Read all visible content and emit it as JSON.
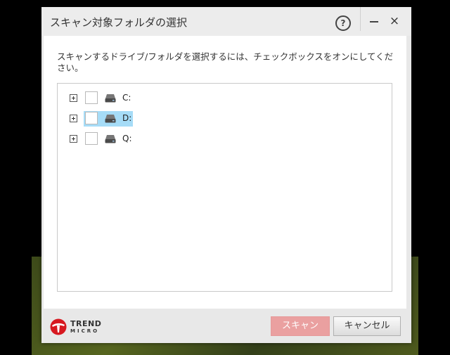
{
  "dialog": {
    "title": "スキャン対象フォルダの選択",
    "help_label": "?",
    "close_label": "×"
  },
  "instruction": "スキャンするドライブ/フォルダを選択するには、チェックボックスをオンにしてください。",
  "drives": [
    {
      "label": "C:",
      "checked": false,
      "selected": false
    },
    {
      "label": "D:",
      "checked": false,
      "selected": true
    },
    {
      "label": "Q:",
      "checked": false,
      "selected": false
    }
  ],
  "logo": {
    "line1": "TREND",
    "line2": "MICRO",
    "color": "#d71920"
  },
  "buttons": {
    "scan_label": "スキャン",
    "cancel_label": "キャンセル"
  },
  "colors": {
    "selection": "#a6dcf7",
    "scan_button_disabled": "#eaa0a0"
  }
}
